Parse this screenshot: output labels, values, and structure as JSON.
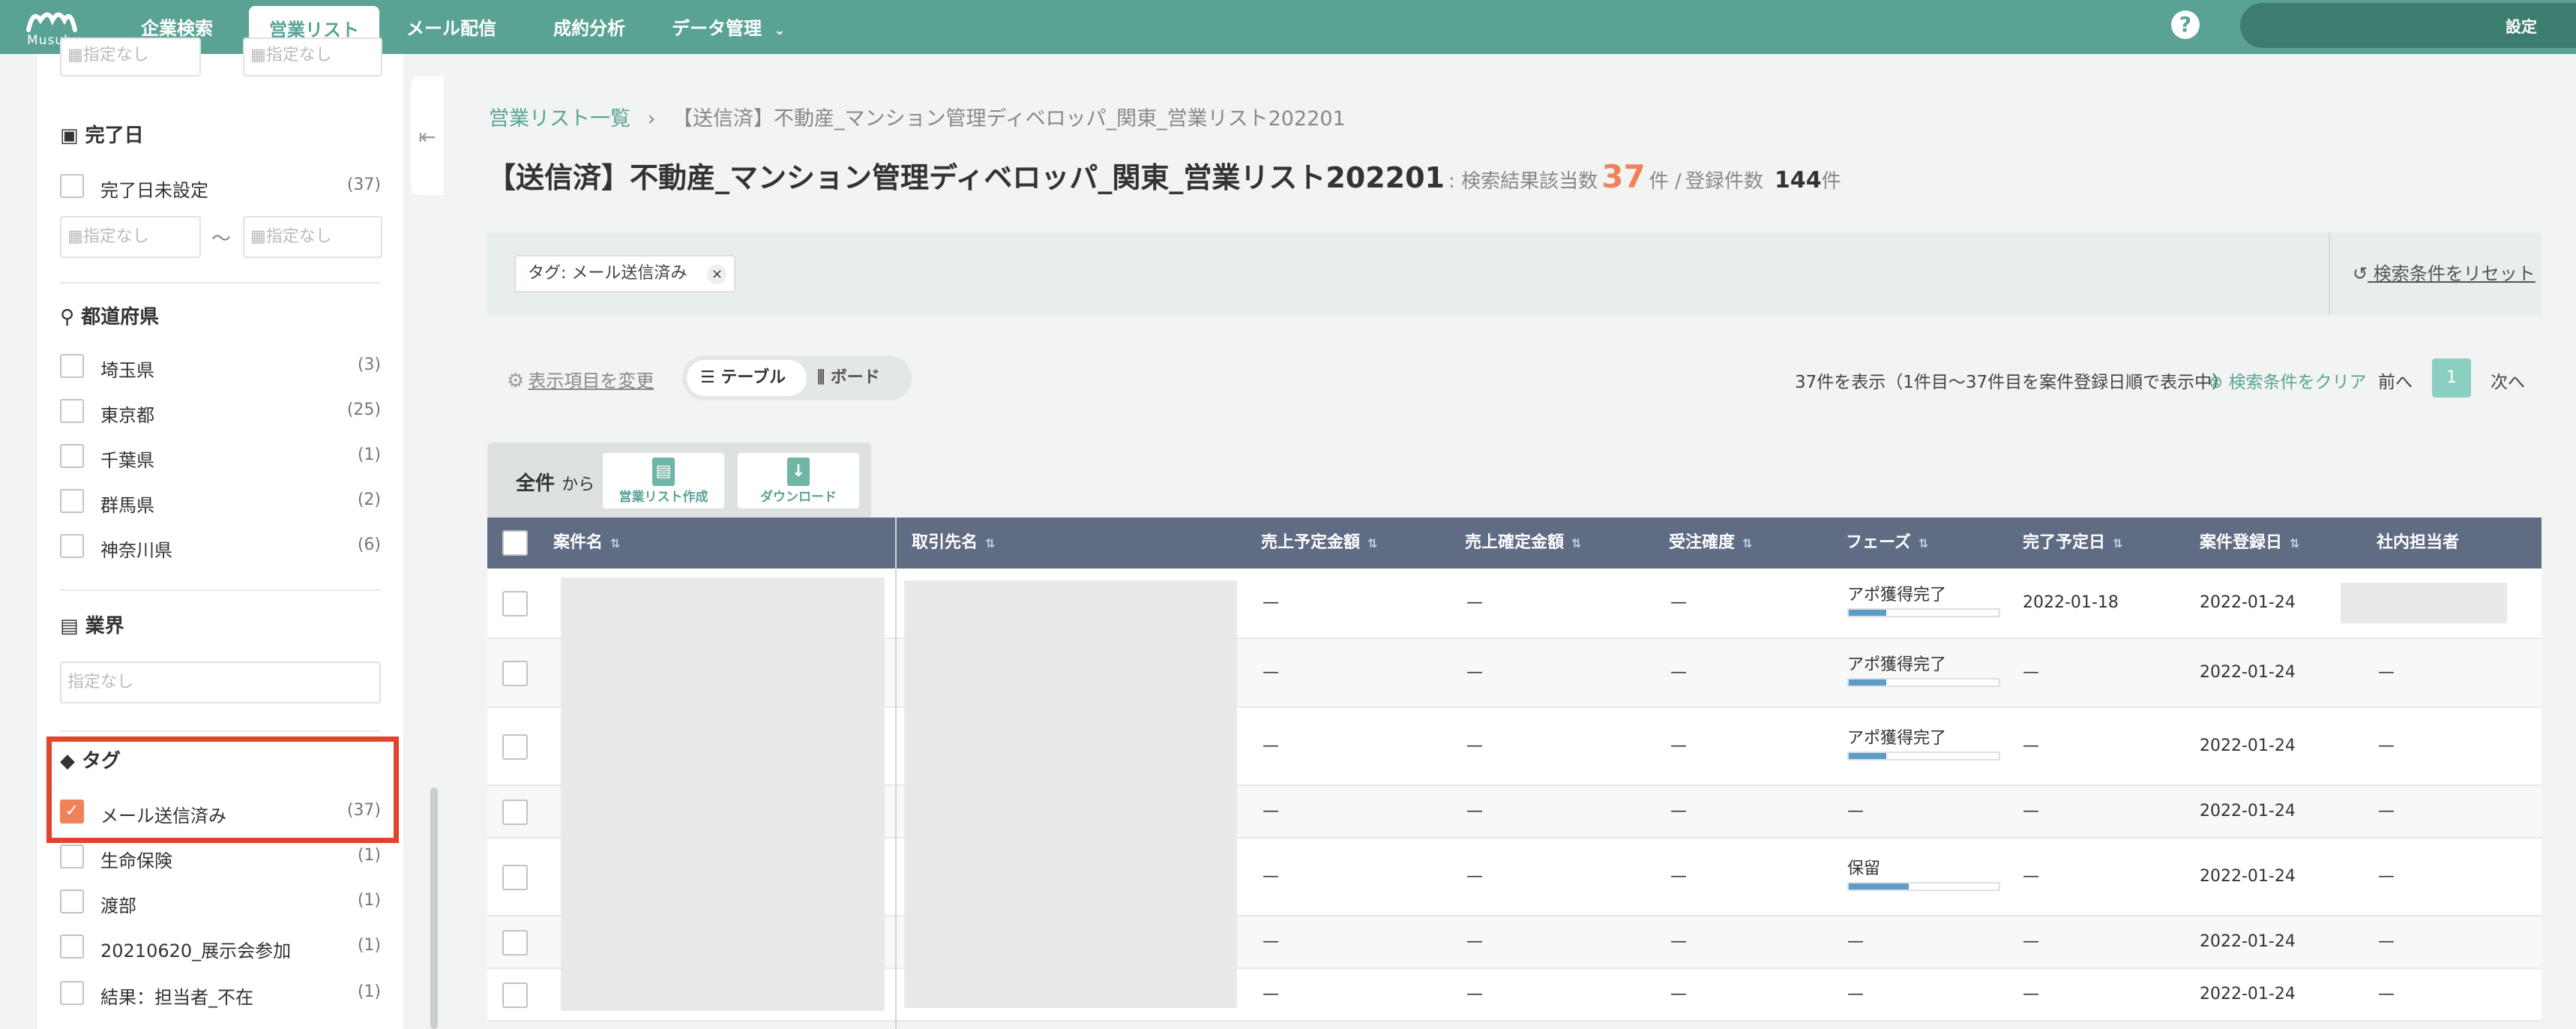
{
  "header": {
    "logo_text": "Musubu",
    "nav": [
      {
        "label": "企業検索"
      },
      {
        "label": "営業リスト"
      },
      {
        "label": "メール配信"
      },
      {
        "label": "成約分析"
      },
      {
        "label": "データ管理"
      }
    ],
    "help_glyph": "?",
    "settings_label": "設定"
  },
  "sidebar": {
    "top_date_placeholder": "指定なし",
    "completion": {
      "title": "完了日",
      "unset_label": "完了日未設定",
      "unset_count": "(37)",
      "from_placeholder": "指定なし",
      "tilde": "〜",
      "to_placeholder": "指定なし"
    },
    "prefecture": {
      "title": "都道府県",
      "items": [
        {
          "label": "埼玉県",
          "count": "(3)"
        },
        {
          "label": "東京都",
          "count": "(25)"
        },
        {
          "label": "千葉県",
          "count": "(1)"
        },
        {
          "label": "群馬県",
          "count": "(2)"
        },
        {
          "label": "神奈川県",
          "count": "(6)"
        }
      ]
    },
    "industry": {
      "title": "業界",
      "placeholder": "指定なし"
    },
    "tag": {
      "title": "タグ",
      "items": [
        {
          "label": "メール送信済み",
          "count": "(37)",
          "checked": true
        },
        {
          "label": "生命保険",
          "count": "(1)"
        },
        {
          "label": "渡部",
          "count": "(1)"
        },
        {
          "label": "20210620_展示会参加",
          "count": "(1)"
        },
        {
          "label": "結果：担当者_不在",
          "count": "(1)"
        }
      ]
    }
  },
  "main": {
    "breadcrumb_link": "営業リスト一覧",
    "breadcrumb_sep": "›",
    "breadcrumb_current": "【送信済】不動産_マンション管理ディベロッパ_関東_営業リスト202201",
    "title": "【送信済】不動産_マンション管理ディベロッパ_関東_営業リスト202201",
    "hits_label": ": 検索結果該当数",
    "hits_value": "37",
    "hits_unit": "件 /",
    "registered_label": "登録件数",
    "registered_value": "144",
    "registered_unit": "件",
    "filter_chip": "タグ: メール送信済み",
    "chip_close": "×",
    "reset_label": "検索条件をリセット",
    "change_columns": "表示項目を変更",
    "view_table": "テーブル",
    "view_board": "ボード",
    "result_summary": "37件を表示（1件目〜37件目を案件登録日順で表示中）",
    "clear_conditions": "検索条件をクリア",
    "prev": "前へ",
    "page": "1",
    "next": "次へ",
    "bulk_from_all": "全件",
    "bulk_from_suffix": "から",
    "create_list": "営業リスト作成",
    "download": "ダウンロード"
  },
  "table": {
    "headers": [
      "案件名",
      "取引先名",
      "売上予定金額",
      "売上確定金額",
      "受注確度",
      "フェーズ",
      "完了予定日",
      "案件登録日",
      "社内担当者"
    ],
    "rows": [
      {
        "amount_plan": "—",
        "amount_fixed": "—",
        "probability": "—",
        "phase": "アポ獲得完了",
        "phase_pct": 0.25,
        "due": "2022-01-18",
        "registered": "2022-01-24",
        "owner": ""
      },
      {
        "amount_plan": "—",
        "amount_fixed": "—",
        "probability": "—",
        "phase": "アポ獲得完了",
        "phase_pct": 0.25,
        "due": "—",
        "registered": "2022-01-24",
        "owner": "—"
      },
      {
        "amount_plan": "—",
        "amount_fixed": "—",
        "probability": "—",
        "phase": "アポ獲得完了",
        "phase_pct": 0.25,
        "due": "—",
        "registered": "2022-01-24",
        "owner": "—"
      },
      {
        "amount_plan": "—",
        "amount_fixed": "—",
        "probability": "—",
        "phase": "—",
        "phase_pct": 0,
        "due": "—",
        "registered": "2022-01-24",
        "owner": "—"
      },
      {
        "amount_plan": "—",
        "amount_fixed": "—",
        "probability": "—",
        "phase": "保留",
        "phase_pct": 0.4,
        "due": "—",
        "registered": "2022-01-24",
        "owner": "—"
      },
      {
        "amount_plan": "—",
        "amount_fixed": "—",
        "probability": "—",
        "phase": "—",
        "phase_pct": 0,
        "due": "—",
        "registered": "2022-01-24",
        "owner": "—"
      },
      {
        "amount_plan": "—",
        "amount_fixed": "—",
        "probability": "—",
        "phase": "—",
        "phase_pct": 0,
        "due": "—",
        "registered": "2022-01-24",
        "owner": "—"
      }
    ]
  },
  "colors": {
    "brand": "#5aa394",
    "accent": "#f0825a",
    "table_header": "#5f6c83",
    "highlight": "#e0442b"
  }
}
